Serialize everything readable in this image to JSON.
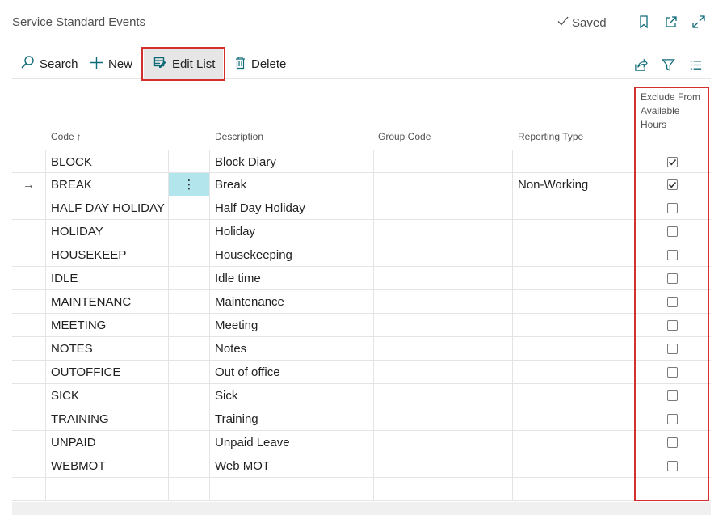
{
  "header": {
    "title": "Service Standard Events",
    "saved_label": "Saved",
    "icons": [
      "bookmark-icon",
      "open-new-window-icon",
      "expand-icon"
    ]
  },
  "toolbar": {
    "search_label": "Search",
    "new_label": "New",
    "edit_list_label": "Edit List",
    "delete_label": "Delete",
    "right_icons": [
      "share-icon",
      "filter-icon",
      "list-view-icon"
    ]
  },
  "columns": {
    "code": "Code",
    "code_sort": "↑",
    "description": "Description",
    "group_code": "Group Code",
    "reporting_type": "Reporting Type",
    "exclude": "Exclude From Available Hours"
  },
  "colors": {
    "accent": "#b3e5ec",
    "highlight": "#d32f2f"
  },
  "rows": [
    {
      "code": "BLOCK",
      "description": "Block Diary",
      "group_code": "",
      "reporting_type": "",
      "exclude": true
    },
    {
      "code": "BREAK",
      "description": "Break",
      "group_code": "",
      "reporting_type": "Non-Working",
      "exclude": true,
      "selected": true,
      "indicator": "→",
      "menu": "⋮"
    },
    {
      "code": "HALF DAY HOLIDAY",
      "description": "Half Day Holiday",
      "group_code": "",
      "reporting_type": "",
      "exclude": false
    },
    {
      "code": "HOLIDAY",
      "description": "Holiday",
      "group_code": "",
      "reporting_type": "",
      "exclude": false
    },
    {
      "code": "HOUSEKEEP",
      "description": "Housekeeping",
      "group_code": "",
      "reporting_type": "",
      "exclude": false
    },
    {
      "code": "IDLE",
      "description": "Idle time",
      "group_code": "",
      "reporting_type": "",
      "exclude": false
    },
    {
      "code": "MAINTENANC",
      "description": "Maintenance",
      "group_code": "",
      "reporting_type": "",
      "exclude": false
    },
    {
      "code": "MEETING",
      "description": "Meeting",
      "group_code": "",
      "reporting_type": "",
      "exclude": false
    },
    {
      "code": "NOTES",
      "description": "Notes",
      "group_code": "",
      "reporting_type": "",
      "exclude": false
    },
    {
      "code": "OUTOFFICE",
      "description": "Out of office",
      "group_code": "",
      "reporting_type": "",
      "exclude": false
    },
    {
      "code": "SICK",
      "description": "Sick",
      "group_code": "",
      "reporting_type": "",
      "exclude": false
    },
    {
      "code": "TRAINING",
      "description": "Training",
      "group_code": "",
      "reporting_type": "",
      "exclude": false
    },
    {
      "code": "UNPAID",
      "description": "Unpaid Leave",
      "group_code": "",
      "reporting_type": "",
      "exclude": false
    },
    {
      "code": "WEBMOT",
      "description": "Web MOT",
      "group_code": "",
      "reporting_type": "",
      "exclude": false
    }
  ]
}
